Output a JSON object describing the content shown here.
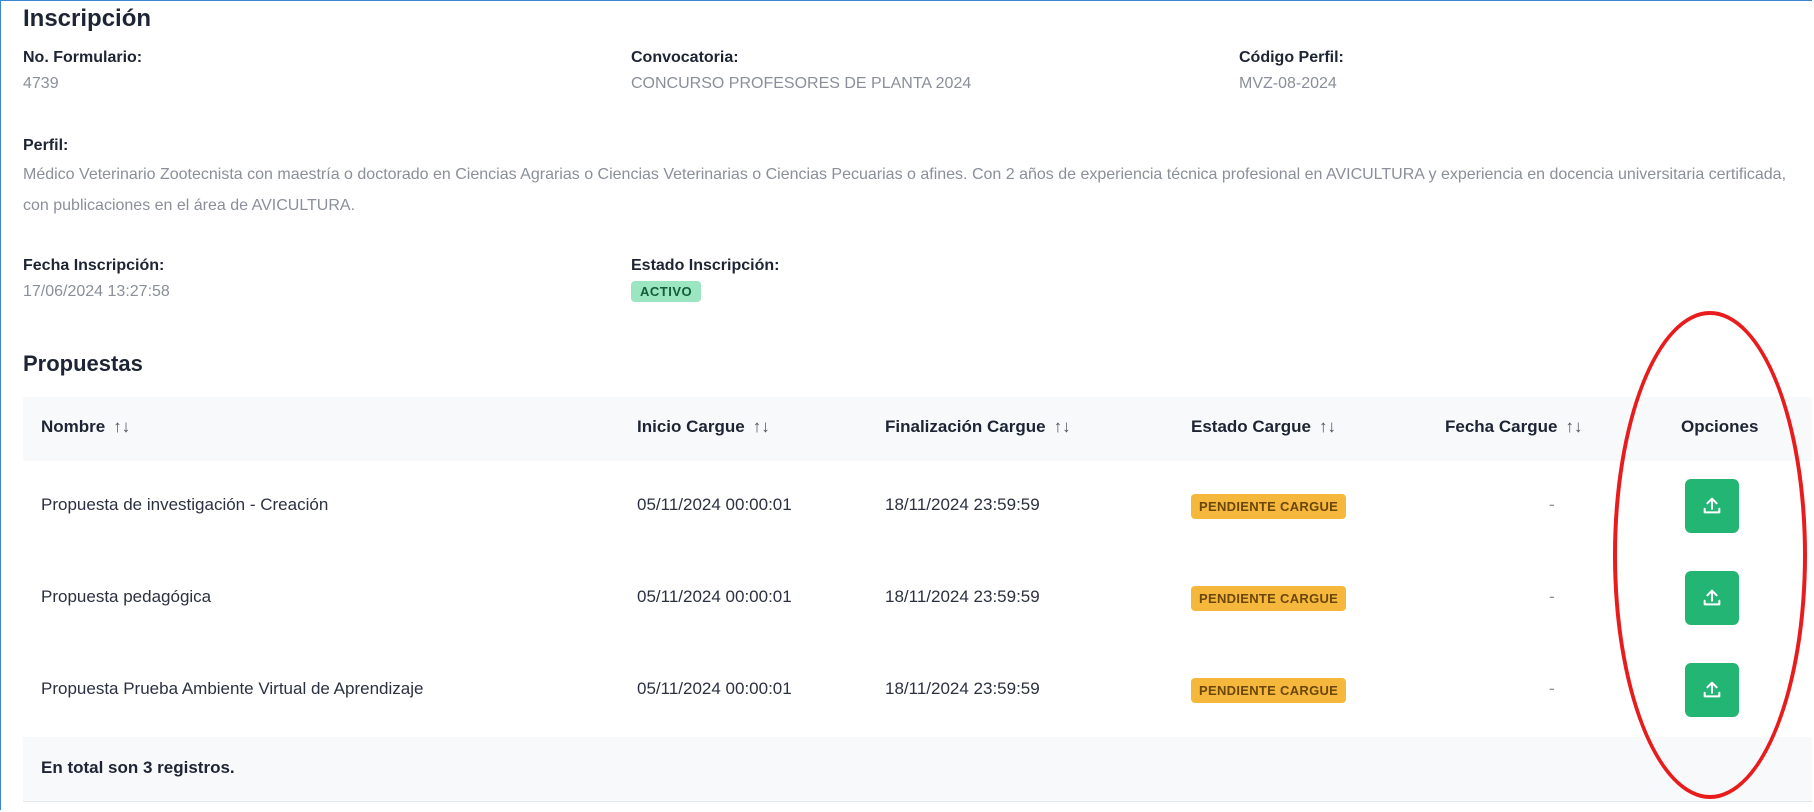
{
  "inscripcion": {
    "title": "Inscripción",
    "no_formulario": {
      "label": "No. Formulario:",
      "value": "4739"
    },
    "convocatoria": {
      "label": "Convocatoria:",
      "value": "CONCURSO PROFESORES DE PLANTA 2024"
    },
    "codigo_perfil": {
      "label": "Código Perfil:",
      "value": "MVZ-08-2024"
    },
    "perfil": {
      "label": "Perfil:",
      "value": "Médico Veterinario Zootecnista con maestría o doctorado en Ciencias Agrarias o Ciencias Veterinarias o Ciencias Pecuarias o afines. Con 2 años de experiencia técnica profesional en AVICULTURA y experiencia en docencia universitaria certificada, con publicaciones en el área de AVICULTURA."
    },
    "fecha_inscripcion": {
      "label": "Fecha Inscripción:",
      "value": "17/06/2024 13:27:58"
    },
    "estado_inscripcion": {
      "label": "Estado Inscripción:",
      "value": "ACTIVO"
    }
  },
  "propuestas": {
    "title": "Propuestas",
    "columns": {
      "nombre": "Nombre",
      "inicio": "Inicio Cargue",
      "fin": "Finalización Cargue",
      "estado": "Estado Cargue",
      "fecha": "Fecha Cargue",
      "opciones": "Opciones"
    },
    "sort_glyph": "↑↓",
    "rows": [
      {
        "nombre": "Propuesta de investigación - Creación",
        "inicio": "05/11/2024 00:00:01",
        "fin": "18/11/2024 23:59:59",
        "estado": "PENDIENTE CARGUE",
        "fecha": "-"
      },
      {
        "nombre": "Propuesta pedagógica",
        "inicio": "05/11/2024 00:00:01",
        "fin": "18/11/2024 23:59:59",
        "estado": "PENDIENTE CARGUE",
        "fecha": "-"
      },
      {
        "nombre": "Propuesta Prueba Ambiente Virtual de Aprendizaje",
        "inicio": "05/11/2024 00:00:01",
        "fin": "18/11/2024 23:59:59",
        "estado": "PENDIENTE CARGUE",
        "fecha": "-"
      }
    ],
    "footer": "En total son 3 registros."
  },
  "icons": {
    "upload": "upload-icon"
  },
  "colors": {
    "active_badge_bg": "#9be5c0",
    "pending_badge_bg": "#f5b83d",
    "upload_button_bg": "#22b573",
    "annotation": "#e81c1c",
    "frame_border": "#3b87d6"
  }
}
